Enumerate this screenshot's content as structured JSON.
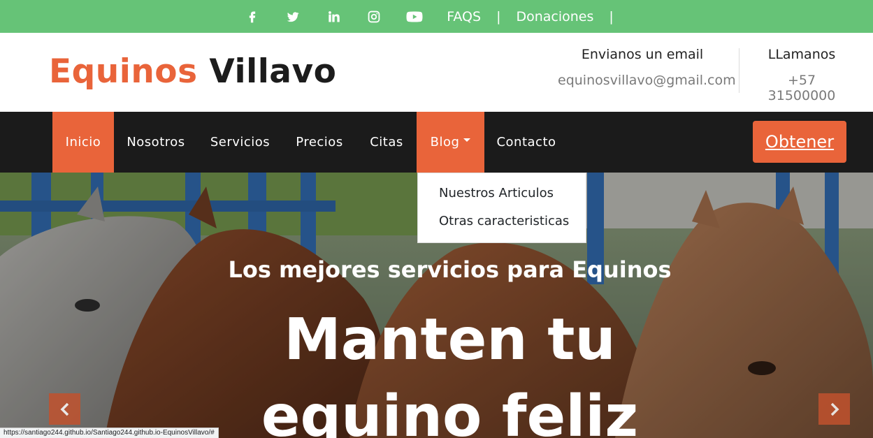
{
  "topbar": {
    "social": [
      {
        "icon": "facebook-icon"
      },
      {
        "icon": "twitter-icon"
      },
      {
        "icon": "linkedin-icon"
      },
      {
        "icon": "instagram-icon"
      },
      {
        "icon": "youtube-icon"
      }
    ],
    "faqs": "FAQS",
    "separator": "|",
    "donaciones": "Donaciones"
  },
  "header": {
    "brand_part1": "Equinos",
    "brand_part2": "Villavo",
    "email_label": "Envianos un email",
    "email_value": "equinosvillavo@gmail.com",
    "phone_label": "LLamanos",
    "phone_value": "+57 31500000"
  },
  "nav": {
    "items": [
      {
        "label": "Inicio",
        "active": true
      },
      {
        "label": "Nosotros"
      },
      {
        "label": "Servicios"
      },
      {
        "label": "Precios"
      },
      {
        "label": "Citas"
      },
      {
        "label": "Blog",
        "active": true,
        "dropdown": true
      },
      {
        "label": "Contacto"
      }
    ],
    "cta": "Obtener",
    "dropdown": [
      "Nuestros Articulos",
      "Otras caracteristicas"
    ]
  },
  "hero": {
    "subtitle": "Los mejores servicios para Equinos",
    "headline": "Manten tu equino feliz"
  },
  "status_url": "https://santiago244.github.io/Santiago244.github.io-EquinosVillavo/#",
  "colors": {
    "accent": "#e9643a",
    "topbar": "#66c377",
    "nav": "#1b1b1b"
  }
}
